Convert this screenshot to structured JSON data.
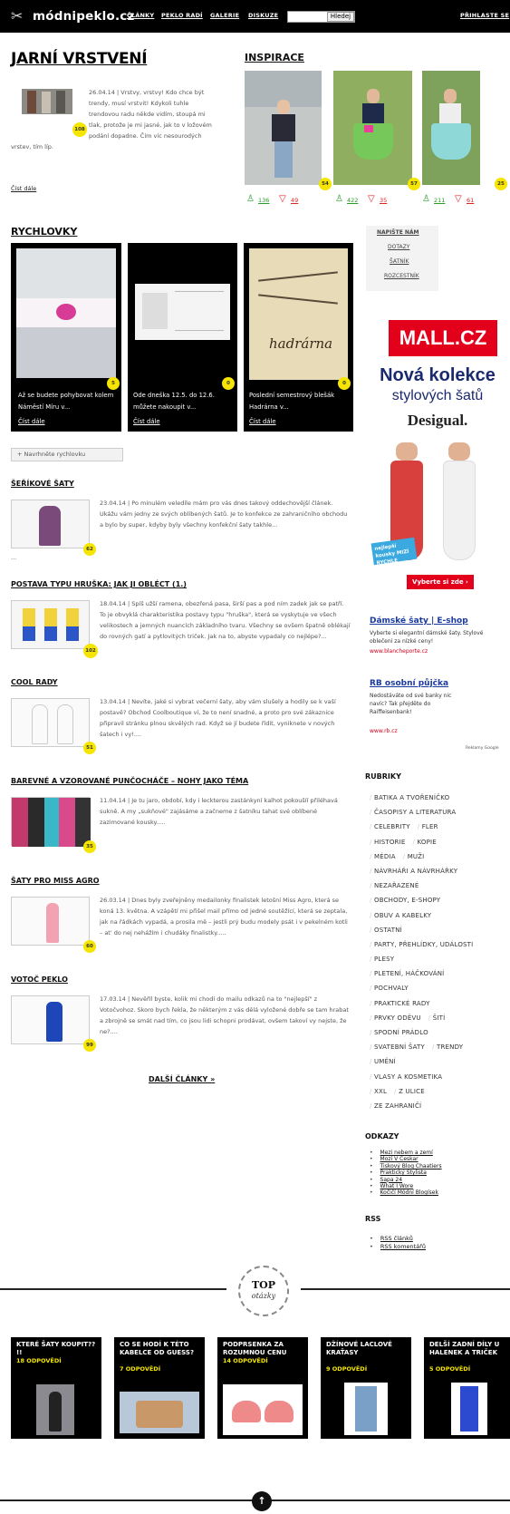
{
  "header": {
    "logo": "módnipeklo.cz",
    "nav": [
      "ČLÁNKY",
      "PEKLO RADÍ",
      "GALERIE",
      "DISKUZE"
    ],
    "search_button": "Hledej",
    "login": "PŘIHLASTE SE"
  },
  "featured": {
    "title": "JARNÍ VRSTVENÍ",
    "text": "26.04.14 | Vrstvy, vrstvy! Kdo chce být trendy, musí vrstvit! Kdykoli tuhle trendovou radu někde vidím, stoupá mi tlak, protože je mi jasné, jak to v ložovém podání dopadne. Čím víc nesourodých vrstev, tím líp.",
    "read_more": "Číst dále",
    "badge": "108"
  },
  "inspirace": {
    "title": "INSPIRACE",
    "items": [
      {
        "badge": "54",
        "likes": "136",
        "dislikes": "49"
      },
      {
        "badge": "57",
        "likes": "422",
        "dislikes": "35"
      },
      {
        "badge": "25",
        "likes": "211",
        "dislikes": "61"
      }
    ]
  },
  "rychlovky": {
    "title": "RYCHLOVKY",
    "cards": [
      {
        "caption": "Až se budete pohybovat kolem Náměstí Míru v...",
        "read": "Číst dále",
        "badge": "5"
      },
      {
        "caption": "Ode dneška 12.5. do 12.6. můžete nakoupit v...",
        "read": "Číst dále",
        "badge": "0"
      },
      {
        "caption": "Poslední semestrový blešák Hadrárna v...",
        "read": "Číst dále",
        "badge": "0"
      }
    ],
    "suggest": "+ Navrhněte rychlovku"
  },
  "articles": [
    {
      "title": "ŠEŘÍKOVÉ ŠATY",
      "text": "23.04.14 | Po minulém veledíle mám pro vás dnes takový oddechovější článek. Ukážu vám jedny ze svých oblíbených šatů. Je to konfekce ze zahraničního obchodu a bylo by super, kdyby byly všechny konfekční šaty takhle...",
      "tail": "...",
      "badge": "62"
    },
    {
      "title": "POSTAVA TYPU HRUŠKA: JAK JI OBLÉCT (1.)",
      "text": "18.04.14 | Spíš užší ramena, obezřená pasa, širší pas a pod ním zadek jak se patří. To je obvyklá charakteristika postavy typu \"hruška\", která se vyskytuje ve všech velikostech a jemných nuancích základního tvaru. Všechny se ovšem špatně oblékají do rovných gatí a pytlovitých triček. Jak na to, abyste vypadaly co nejlépe?...",
      "tail": "",
      "badge": "102"
    },
    {
      "title": "COOL RADY",
      "text": "13.04.14 | Nevíte, jaké si vybrat večerní šaty, aby vám slušely a hodily se k vaší postavě? Obchod Coolboutique ví, že to není snadné, a proto pro své zákaznice připravil stránku plnou skvělých rad. Když se jí budete řídit, vyniknete v nových šatech i vy!....",
      "tail": "",
      "badge": "51"
    },
    {
      "title": "BAREVNÉ A VZOROVANÉ PUNČOCHÁČE – NOHY JAKO TÉMA",
      "text": "11.04.14 | Je tu jaro, období, kdy i leckterou zastánkyní kalhot pokoušíí přiléhavá sukně. A my „sukňové\" zajásáme a začneme z šatníku tahat své oblíbené zazimované kousky.....",
      "tail": "",
      "badge": "35"
    },
    {
      "title": "ŠATY PRO MISS AGRO",
      "text": "26.03.14 | Dnes byly zveřejněny medailonky finalistek letošní Miss Agro, která se koná 13. května. A vzápětí mi přišel mail přímo od jedné soutěžící, která se zeptala, jak na řádkách vypadá, a prosila mě – jestli prý budu modely psát i v pekelném kotli – at' do nej nehážím i chudáky finalistky.....",
      "tail": "",
      "badge": "60"
    },
    {
      "title": "VOTOČ PEKLO",
      "text": "17.03.14 | Nevěříl byste, kolik mi chodí do mailu odkazů na to \"nejlepší\" z Votočvohoz. Skoro bych řekla, že některým z vás dělá vyložené dobře se tam hrabat a zbrojně se smát nad tím, co jsou lidi schopni prodávat, ovšem takoví vy nejste, že ne?....",
      "tail": "",
      "badge": "99"
    }
  ],
  "more_articles": "DALŠÍ ČLÁNKY »",
  "sidebar": {
    "write_links": [
      "NAPIŠTE NÁM",
      "DOTAZY",
      "ŠATNÍK",
      "ROZCESTNÍK"
    ],
    "ad_brand": "MALL.CZ",
    "ad_line1": "Nová kolekce",
    "ad_line2": "stylových šatů",
    "ad_logo": "Desigual.",
    "ad_sticker": "nejlepší kousky MIZÍ RYCHLE",
    "ad_cta": "Vyberte si zde ›",
    "ad1_title": "Dámské šaty | E-shop",
    "ad1_text": "Vyberte si elegantní dámské šaty. Stylové oblečení za nízké ceny!",
    "ad1_url": "www.blancheporte.cz",
    "ad2_title": "RB osobní půjčka",
    "ad2_text": "Nedostáváte od své banky nic navíc? Tak přejděte do Raiffeisenbank!",
    "ad2_url": "www.rb.cz",
    "ad_choice": "Reklamy Google",
    "rubriky_title": "RUBRIKY",
    "rubriky": [
      [
        "BATIKA A TVOŘENÍČKO"
      ],
      [
        "ČASOPISY A LITERATURA"
      ],
      [
        "CELEBRITY",
        "FLER"
      ],
      [
        "HISTORIE",
        "KOPIE"
      ],
      [
        "MÉDIA",
        "MUŽI"
      ],
      [
        "NÁVRHÁŘI A NÁVRHÁŘKY"
      ],
      [
        "NEZAŘAZENÉ"
      ],
      [
        "OBCHODY, E-SHOPY"
      ],
      [
        "OBUV A KABELKY"
      ],
      [
        "OSTATNÍ"
      ],
      [
        "PARTY, PŘEHLÍDKY, UDÁLOSTI"
      ],
      [
        "PLESY"
      ],
      [
        "PLETENÍ, HÁČKOVÁNÍ"
      ],
      [
        "POCHVALY"
      ],
      [
        "PRAKTICKÉ RADY"
      ],
      [
        "PRVKY ODĚVU",
        "ŠITÍ"
      ],
      [
        "SPODNÍ PRÁDLO"
      ],
      [
        "SVATEBNÍ ŠATY",
        "TRENDY"
      ],
      [
        "UMĚNÍ"
      ],
      [
        "VLASY A KOSMETIKA"
      ],
      [
        "XXL",
        "Z ULICE"
      ],
      [
        "ZE ZAHRANIČÍ"
      ]
    ],
    "odkazy_title": "ODKAZY",
    "odkazy": [
      "Mezi nebem a zemí",
      "Mozi V Ceskar",
      "Tiskový Blog Chaatiers",
      "Praktický Stylista",
      "Sapa 24",
      "What I Wore",
      "Kočičí Módní Blogísek"
    ],
    "rss_title": "RSS",
    "rss": [
      "RSS článků",
      "RSS komentářů"
    ]
  },
  "top": {
    "label_top": "TOP",
    "label_bottom": "otázky",
    "items": [
      {
        "title": "KTERÉ ŠATY KOUPIT?? !!",
        "count": "18 ODPOVĚDÍ"
      },
      {
        "title": "CO SE HODÍ K TÉTO KABELCE OD GUESS?",
        "count": "7 ODPOVĚDÍ"
      },
      {
        "title": "PODPRSENKA ZA ROZUMNOU CENU",
        "count": "14 ODPOVĚDÍ"
      },
      {
        "title": "DŽÍNOVÉ LACLOVÉ KRAŤASY",
        "count": "9 ODPOVĚDÍ"
      },
      {
        "title": "DELŠÍ ZADNÍ DÍLY U HALENEK A TRIČEK",
        "count": "5 ODPOVĚDÍ"
      }
    ]
  },
  "colors": {
    "accent_yellow": "#f5e500",
    "top_bar": "#000000",
    "mall_red": "#e3001b",
    "ad_link": "#d0001a"
  }
}
